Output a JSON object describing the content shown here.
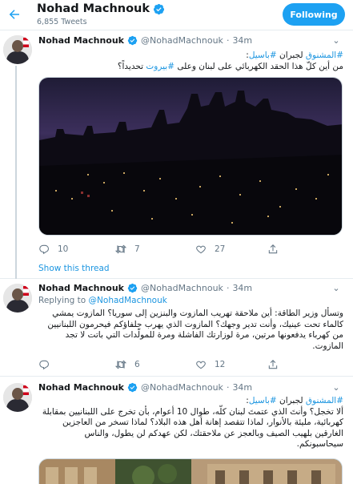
{
  "header": {
    "title": "Nohad Machnouk",
    "tweet_count": "6,855 Tweets",
    "follow_label": "Following"
  },
  "tweets": [
    {
      "name": "Nohad Machnouk",
      "handle": "@NohadMachnouk",
      "sep": "·",
      "time": "34m",
      "text_parts": [
        "#المشنوق",
        " لجبران ",
        "#باسيل",
        ":",
        "من أين كلّ هذا الحقد الكهربائي على لبنان وعلى ",
        "#بيروت",
        " تحديداً؟"
      ],
      "replies": "10",
      "retweets": "7",
      "likes": "27",
      "show_thread": "Show this thread"
    },
    {
      "name": "Nohad Machnouk",
      "handle": "@NohadMachnouk",
      "sep": "·",
      "time": "34m",
      "replying_prefix": "Replying to ",
      "replying_handle": "@NohadMachnouk",
      "text": "وتسأل وزير الطاقة: أين ملاحقة تهريب المازوت والبنزين إلى سوريا؟ المازوت يمشي كالماء تحت عينيك، وأنت تدير وجهك؟ المازوت الذي يهرب حلفاؤكم فيحرمون اللبنانيين من كهرباء يدفعونها مرتين، مرة لوزارتك الفاشلة ومرة للمولّدات التي باتت لا تجد المازوت.",
      "replies": "",
      "retweets": "6",
      "likes": "12"
    },
    {
      "name": "Nohad Machnouk",
      "handle": "@NohadMachnouk",
      "sep": "·",
      "time": "34m",
      "text_parts": [
        "#المشنوق",
        " لجبران ",
        "#باسيل",
        ":",
        "ألا تخجل؟ وأنتَ الذي عتمتَ لبنان كلّه، طوال 10 أعوام، بأن تخرج على اللبنانيين بمقابلة كهربائية، مليئة بالأنوار، لماذا تتقصد إهانة أهل هذه البلاد؟ لماذا تسخر من العاجزين الغارقين بلهيب الصيف وبالعجز عن ملاحقتك، لكن عهدكم لن يطول، والناس سيحاسبونكم."
      ]
    }
  ],
  "colors": {
    "accent": "#1da1f2",
    "link": "#1b95e0",
    "muted": "#657786",
    "border": "#e6ecf0"
  }
}
